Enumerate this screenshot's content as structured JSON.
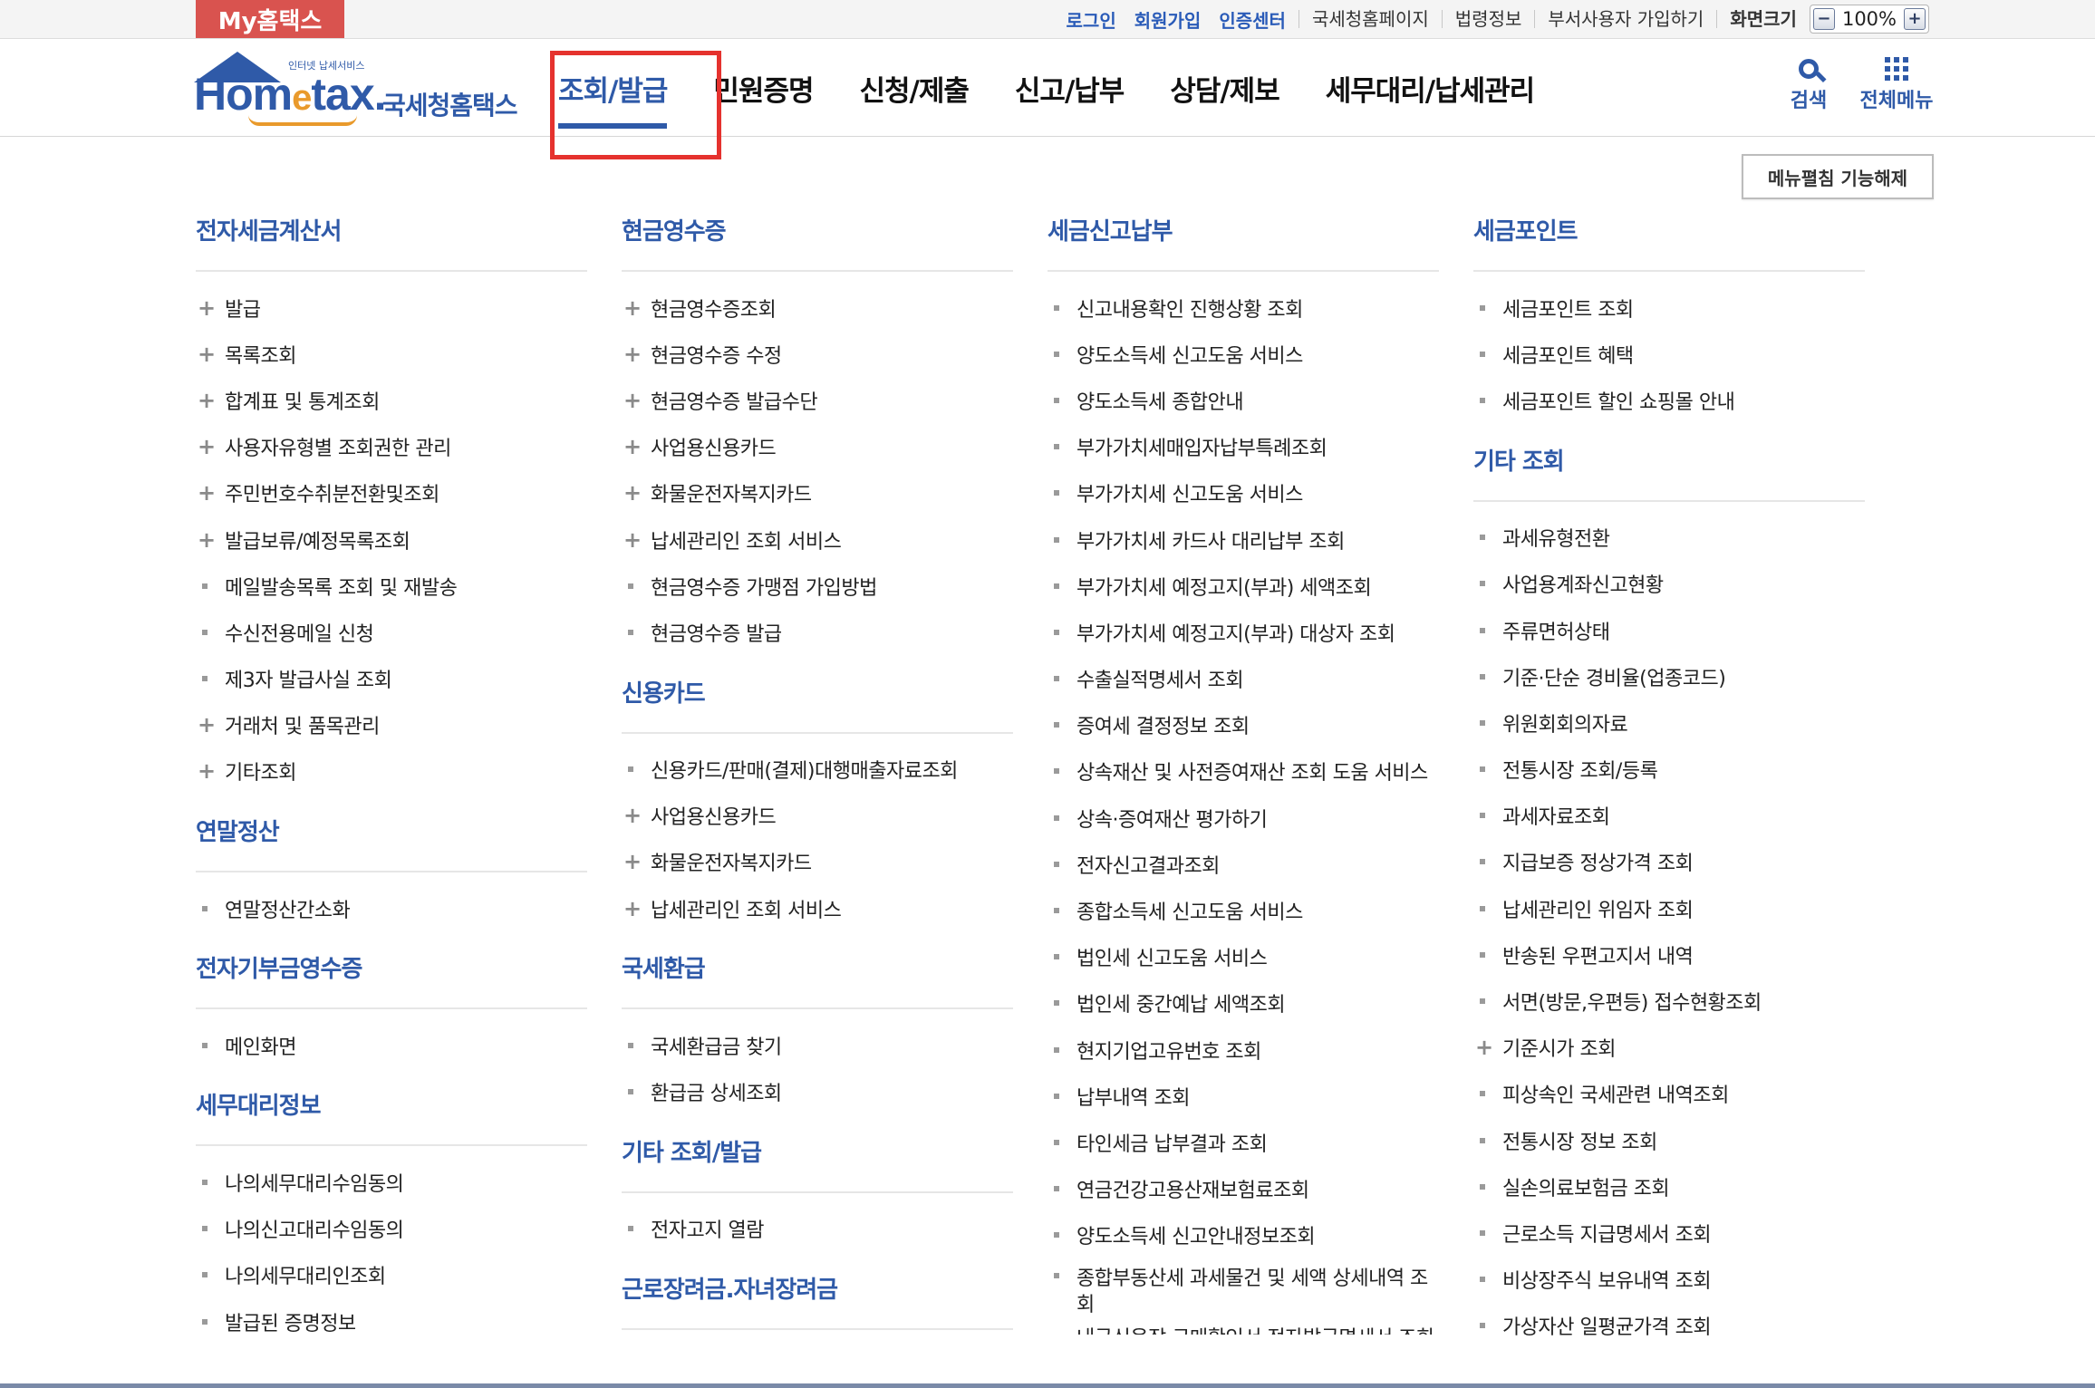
{
  "top": {
    "my_tab": "My홈택스",
    "links_blue": [
      "로그인",
      "회원가입",
      "인증센터"
    ],
    "links": [
      "국세청홈페이지",
      "법령정보",
      "부서사용자 가입하기"
    ],
    "zoom_label": "화면크기",
    "zoom_value": "100%",
    "zoom_minus": "−",
    "zoom_plus": "+"
  },
  "logo": {
    "small": "인터넷 납세서비스",
    "word_a": "Hom",
    "word_e": "e",
    "word_b": "tax.",
    "kname": "국세청홈택스"
  },
  "gnb": [
    {
      "label": "조회/발급",
      "active": true
    },
    {
      "label": "민원증명"
    },
    {
      "label": "신청/제출"
    },
    {
      "label": "신고/납부"
    },
    {
      "label": "상담/제보"
    },
    {
      "label": "세무대리/납세관리"
    }
  ],
  "tools": {
    "search": "검색",
    "allmenu": "전체메뉴"
  },
  "unfold_button": "메뉴펼침 기능해제",
  "columns": [
    [
      {
        "title": "전자세금계산서",
        "items": [
          {
            "t": "발급",
            "m": "plus"
          },
          {
            "t": "목록조회",
            "m": "plus"
          },
          {
            "t": "합계표 및 통계조회",
            "m": "plus"
          },
          {
            "t": "사용자유형별 조회권한 관리",
            "m": "plus"
          },
          {
            "t": "주민번호수취분전환및조회",
            "m": "plus"
          },
          {
            "t": "발급보류/예정목록조회",
            "m": "plus"
          },
          {
            "t": "메일발송목록 조회 및 재발송",
            "m": "sq"
          },
          {
            "t": "수신전용메일 신청",
            "m": "sq"
          },
          {
            "t": "제3자 발급사실 조회",
            "m": "sq"
          },
          {
            "t": "거래처 및 품목관리",
            "m": "plus"
          },
          {
            "t": "기타조회",
            "m": "plus"
          }
        ]
      },
      {
        "title": "연말정산",
        "items": [
          {
            "t": "연말정산간소화",
            "m": "sq"
          }
        ]
      },
      {
        "title": "전자기부금영수증",
        "items": [
          {
            "t": "메인화면",
            "m": "sq"
          }
        ]
      },
      {
        "title": "세무대리정보",
        "items": [
          {
            "t": "나의세무대리수임동의",
            "m": "sq"
          },
          {
            "t": "나의신고대리수임동의",
            "m": "sq"
          },
          {
            "t": "나의세무대리인조회",
            "m": "sq"
          },
          {
            "t": "발급된 증명정보",
            "m": "sq"
          }
        ]
      }
    ],
    [
      {
        "title": "현금영수증",
        "items": [
          {
            "t": "현금영수증조회",
            "m": "plus"
          },
          {
            "t": "현금영수증 수정",
            "m": "plus"
          },
          {
            "t": "현금영수증 발급수단",
            "m": "plus"
          },
          {
            "t": "사업용신용카드",
            "m": "plus"
          },
          {
            "t": "화물운전자복지카드",
            "m": "plus"
          },
          {
            "t": "납세관리인 조회 서비스",
            "m": "plus"
          },
          {
            "t": "현금영수증 가맹점 가입방법",
            "m": "sq"
          },
          {
            "t": "현금영수증 발급",
            "m": "sq"
          }
        ]
      },
      {
        "title": "신용카드",
        "items": [
          {
            "t": "신용카드/판매(결제)대행매출자료조회",
            "m": "sq"
          },
          {
            "t": "사업용신용카드",
            "m": "plus"
          },
          {
            "t": "화물운전자복지카드",
            "m": "plus"
          },
          {
            "t": "납세관리인 조회 서비스",
            "m": "plus"
          }
        ]
      },
      {
        "title": "국세환급",
        "items": [
          {
            "t": "국세환급금 찾기",
            "m": "sq"
          },
          {
            "t": "환급금 상세조회",
            "m": "sq"
          }
        ]
      },
      {
        "title": "기타 조회/발급",
        "items": [
          {
            "t": "전자고지 열람",
            "m": "sq"
          }
        ]
      },
      {
        "title": "근로장려금.자녀장려금",
        "items": []
      }
    ],
    [
      {
        "title": "세금신고납부",
        "items": [
          {
            "t": "신고내용확인 진행상황 조회",
            "m": "sq"
          },
          {
            "t": "양도소득세 신고도움 서비스",
            "m": "sq"
          },
          {
            "t": "양도소득세 종합안내",
            "m": "sq"
          },
          {
            "t": "부가가치세매입자납부특례조회",
            "m": "sq"
          },
          {
            "t": "부가가치세 신고도움 서비스",
            "m": "sq"
          },
          {
            "t": "부가가치세 카드사 대리납부 조회",
            "m": "sq"
          },
          {
            "t": "부가가치세 예정고지(부과) 세액조회",
            "m": "sq"
          },
          {
            "t": "부가가치세 예정고지(부과) 대상자 조회",
            "m": "sq"
          },
          {
            "t": "수출실적명세서 조회",
            "m": "sq"
          },
          {
            "t": "증여세 결정정보 조회",
            "m": "sq"
          },
          {
            "t": "상속재산 및 사전증여재산 조회 도움 서비스",
            "m": "sq"
          },
          {
            "t": "상속·증여재산 평가하기",
            "m": "sq"
          },
          {
            "t": "전자신고결과조회",
            "m": "sq"
          },
          {
            "t": "종합소득세 신고도움 서비스",
            "m": "sq"
          },
          {
            "t": "법인세 신고도움 서비스",
            "m": "sq"
          },
          {
            "t": "법인세 중간예납 세액조회",
            "m": "sq"
          },
          {
            "t": "현지기업고유번호 조회",
            "m": "sq"
          },
          {
            "t": "납부내역 조회",
            "m": "sq"
          },
          {
            "t": "타인세금 납부결과 조회",
            "m": "sq"
          },
          {
            "t": "연금건강고용산재보험료조회",
            "m": "sq"
          },
          {
            "t": "양도소득세 신고안내정보조회",
            "m": "sq"
          },
          {
            "t": "종합부동산세 과세물건 및 세액 상세내역 조회",
            "m": "sq",
            "wrap": true
          },
          {
            "t": "내국신용장 구매확인서 전자발급명세서 조회",
            "m": "none",
            "clip": true
          }
        ]
      }
    ],
    [
      {
        "title": "세금포인트",
        "items": [
          {
            "t": "세금포인트 조회",
            "m": "sq"
          },
          {
            "t": "세금포인트 혜택",
            "m": "sq"
          },
          {
            "t": "세금포인트 할인 쇼핑몰 안내",
            "m": "sq"
          }
        ]
      },
      {
        "title": "기타 조회",
        "items": [
          {
            "t": "과세유형전환",
            "m": "sq"
          },
          {
            "t": "사업용계좌신고현황",
            "m": "sq"
          },
          {
            "t": "주류면허상태",
            "m": "sq"
          },
          {
            "t": "기준·단순 경비율(업종코드)",
            "m": "sq"
          },
          {
            "t": "위원회회의자료",
            "m": "sq"
          },
          {
            "t": "전통시장 조회/등록",
            "m": "sq"
          },
          {
            "t": "과세자료조회",
            "m": "sq"
          },
          {
            "t": "지급보증 정상가격 조회",
            "m": "sq"
          },
          {
            "t": "납세관리인 위임자 조회",
            "m": "sq"
          },
          {
            "t": "반송된 우편고지서 내역",
            "m": "sq"
          },
          {
            "t": "서면(방문,우편등) 접수현황조회",
            "m": "sq"
          },
          {
            "t": "기준시가 조회",
            "m": "plus"
          },
          {
            "t": "피상속인 국세관련 내역조회",
            "m": "sq"
          },
          {
            "t": "전통시장 정보 조회",
            "m": "sq"
          },
          {
            "t": "실손의료보험금 조회",
            "m": "sq"
          },
          {
            "t": "근로소득 지급명세서 조회",
            "m": "sq"
          },
          {
            "t": "비상장주식 보유내역 조회",
            "m": "sq"
          },
          {
            "t": "가상자산 일평균가격 조회",
            "m": "sq"
          }
        ]
      }
    ]
  ]
}
